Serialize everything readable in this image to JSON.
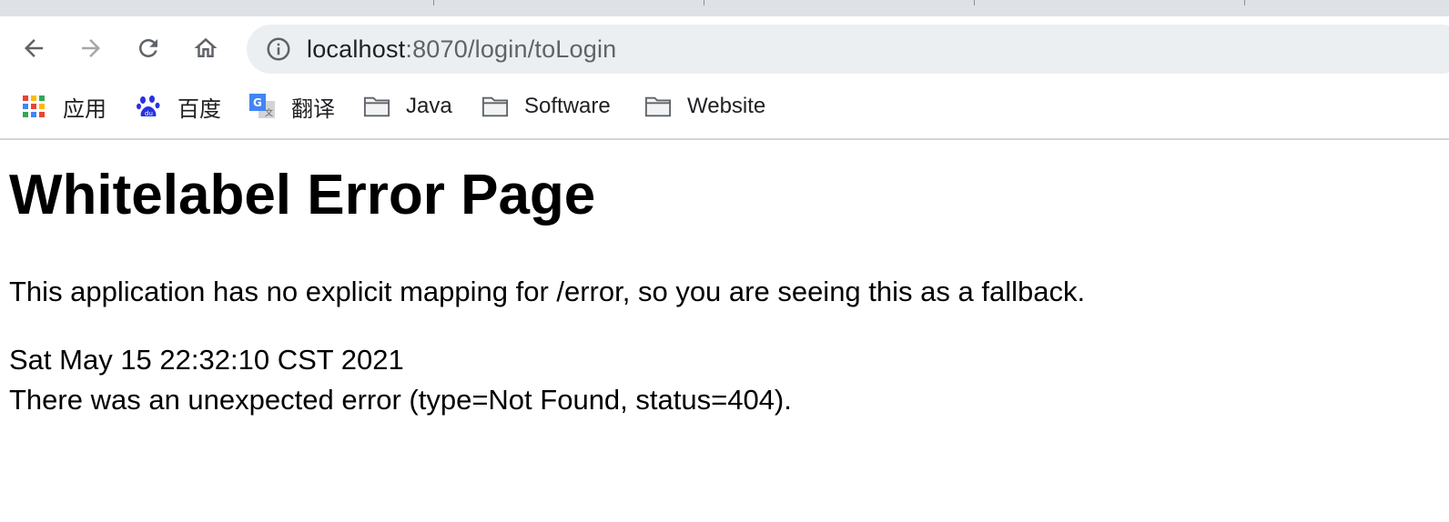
{
  "browser": {
    "url": {
      "host": "localhost",
      "path": ":8070/login/toLogin"
    },
    "nav": {
      "back_icon": "arrow-left-icon",
      "forward_icon": "arrow-right-icon",
      "reload_icon": "reload-icon",
      "home_icon": "home-icon",
      "info_icon": "info-icon"
    },
    "bookmarks": [
      {
        "label": "应用",
        "icon": "apps-grid-icon"
      },
      {
        "label": "百度",
        "icon": "baidu-paw-icon"
      },
      {
        "label": "翻译",
        "icon": "google-translate-icon"
      },
      {
        "label": "Java",
        "icon": "folder-icon"
      },
      {
        "label": "Software",
        "icon": "folder-icon"
      },
      {
        "label": "Website",
        "icon": "folder-icon"
      }
    ]
  },
  "page": {
    "title": "Whitelabel Error Page",
    "message": "This application has no explicit mapping for /error, so you are seeing this as a fallback.",
    "timestamp": "Sat May 15 22:32:10 CST 2021",
    "error": "There was an unexpected error (type=Not Found, status=404)."
  },
  "colors": {
    "toolbar_bg": "#ffffff",
    "omnibox_bg": "#eceff1",
    "tabstrip_bg": "#dee1e6",
    "icon_gray": "#5f6368",
    "disabled_gray": "#a5a8ab"
  }
}
